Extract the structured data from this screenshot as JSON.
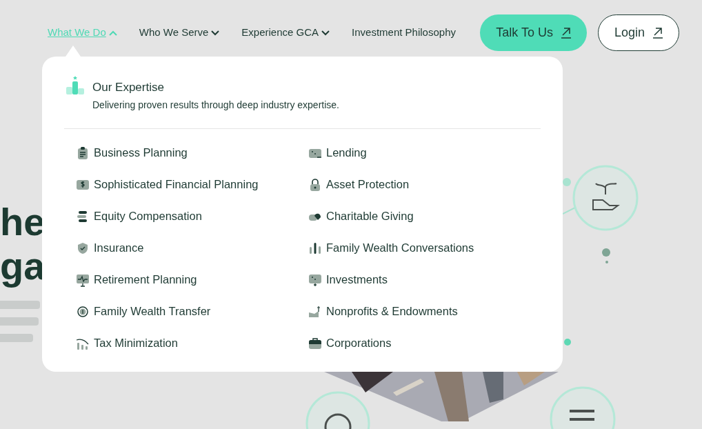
{
  "nav": {
    "items": [
      {
        "label": "What We Do",
        "kind": "dropdown",
        "selected": true
      },
      {
        "label": "Who We Serve",
        "kind": "dropdown",
        "selected": false
      },
      {
        "label": "Experience GCA",
        "kind": "dropdown",
        "selected": false
      },
      {
        "label": "Investment Philosophy",
        "kind": "link",
        "selected": false
      }
    ],
    "buttons": [
      {
        "label": "Talk To Us",
        "kind": "primary"
      },
      {
        "label": "Login",
        "kind": "outline"
      }
    ]
  },
  "hero": {
    "heading": [
      "he",
      "ga"
    ]
  },
  "menu": {
    "title": "Our Expertise",
    "subtitle": "Delivering proven results through deep industry expertise.",
    "columns": [
      [
        {
          "label": "Business Planning"
        },
        {
          "label": "Sophisticated Financial Planning"
        },
        {
          "label": "Equity Compensation"
        },
        {
          "label": "Insurance"
        },
        {
          "label": "Retirement Planning"
        },
        {
          "label": "Family Wealth Transfer"
        },
        {
          "label": "Tax Minimization"
        }
      ],
      [
        {
          "label": "Lending"
        },
        {
          "label": "Asset Protection"
        },
        {
          "label": "Charitable Giving"
        },
        {
          "label": "Family Wealth Conversations"
        },
        {
          "label": "Investments"
        },
        {
          "label": "Nonprofits & Endowments"
        },
        {
          "label": "Corporations"
        }
      ]
    ]
  }
}
